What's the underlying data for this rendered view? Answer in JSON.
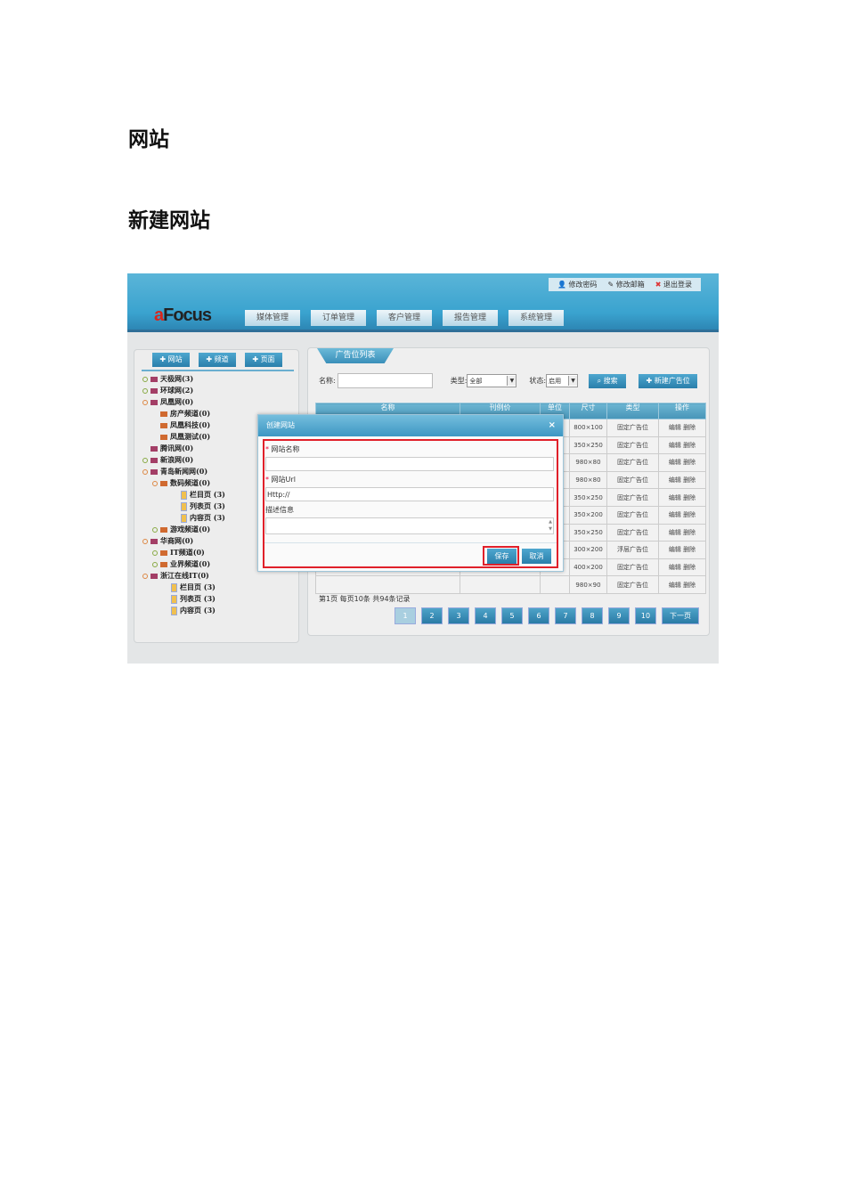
{
  "doc": {
    "heading1": "网站",
    "heading2": "新建网站"
  },
  "header": {
    "links": [
      "修改密码",
      "修改邮箱",
      "退出登录"
    ],
    "logo": "aFocus",
    "tabs": [
      "媒体管理",
      "订单管理",
      "客户管理",
      "报告管理",
      "系统管理"
    ]
  },
  "sidebar": {
    "buttons": [
      "✚ 网站",
      "✚ 频道",
      "✚ 页面"
    ],
    "tree": [
      {
        "label": "天极网(3)",
        "level": 0,
        "type": "site",
        "dot": "g"
      },
      {
        "label": "环球网(2)",
        "level": 0,
        "type": "site",
        "dot": "g"
      },
      {
        "label": "凤凰网(0)",
        "level": 0,
        "type": "site",
        "dot": "o"
      },
      {
        "label": "房产频道(0)",
        "level": 1,
        "type": "ch",
        "dot": ""
      },
      {
        "label": "凤凰科技(0)",
        "level": 1,
        "type": "ch",
        "dot": ""
      },
      {
        "label": "凤凰测试(0)",
        "level": 1,
        "type": "ch",
        "dot": ""
      },
      {
        "label": "腾讯网(0)",
        "level": 0,
        "type": "site",
        "dot": ""
      },
      {
        "label": "新浪网(0)",
        "level": 0,
        "type": "site",
        "dot": "g"
      },
      {
        "label": "青岛新闻网(0)",
        "level": 0,
        "type": "site",
        "dot": "o"
      },
      {
        "label": "数码频道(0)",
        "level": 1,
        "type": "ch",
        "dot": "o"
      },
      {
        "label": "栏目页 (3)",
        "level": 2,
        "type": "pg",
        "dot": ""
      },
      {
        "label": "列表页 (3)",
        "level": 2,
        "type": "pg",
        "dot": ""
      },
      {
        "label": "内容页 (3)",
        "level": 2,
        "type": "pg",
        "dot": ""
      },
      {
        "label": "游戏频道(0)",
        "level": 1,
        "type": "ch",
        "dot": "g"
      },
      {
        "label": "华商网(0)",
        "level": 0,
        "type": "site",
        "dot": "o"
      },
      {
        "label": "IT频道(0)",
        "level": 1,
        "type": "ch",
        "dot": "g"
      },
      {
        "label": "业界频道(0)",
        "level": 1,
        "type": "ch",
        "dot": "g"
      },
      {
        "label": "浙江在线IT(0)",
        "level": 0,
        "type": "site",
        "dot": "o"
      },
      {
        "label": "栏目页 (3)",
        "level": 1,
        "type": "pg",
        "dot": ""
      },
      {
        "label": "列表页 (3)",
        "level": 1,
        "type": "pg",
        "dot": ""
      },
      {
        "label": "内容页 (3)",
        "level": 1,
        "type": "pg",
        "dot": ""
      }
    ]
  },
  "main": {
    "panel_title": "广告位列表",
    "name_label": "名称:",
    "type_label": "类型:",
    "type_value": "全部",
    "status_label": "状态:",
    "status_value": "启用",
    "search": "⌕ 搜索",
    "new": "✚ 新建广告位",
    "columns": [
      "名称",
      "刊例价",
      "单位",
      "尺寸",
      "类型",
      "操作"
    ],
    "rows": [
      [
        "800×100",
        "固定广告位"
      ],
      [
        "350×250",
        "固定广告位"
      ],
      [
        "980×80",
        "固定广告位"
      ],
      [
        "980×80",
        "固定广告位"
      ],
      [
        "350×250",
        "固定广告位"
      ],
      [
        "350×200",
        "固定广告位"
      ],
      [
        "350×250",
        "固定广告位"
      ],
      [
        "300×200",
        "浮层广告位"
      ],
      [
        "400×200",
        "固定广告位"
      ],
      [
        "980×90",
        "固定广告位"
      ]
    ],
    "edit": "编辑",
    "delete": "删除",
    "page_info": "第1页  每页10条  共94条记录",
    "pages": [
      "1",
      "2",
      "3",
      "4",
      "5",
      "6",
      "7",
      "8",
      "9",
      "10"
    ],
    "next": "下一页"
  },
  "dialog": {
    "title": "创建网站",
    "close": "×",
    "name_label": "网站名称",
    "url_label": "网站Url",
    "url_value": "Http://",
    "desc_label": "描述信息",
    "save": "保存",
    "cancel": "取消",
    "required": "*"
  }
}
